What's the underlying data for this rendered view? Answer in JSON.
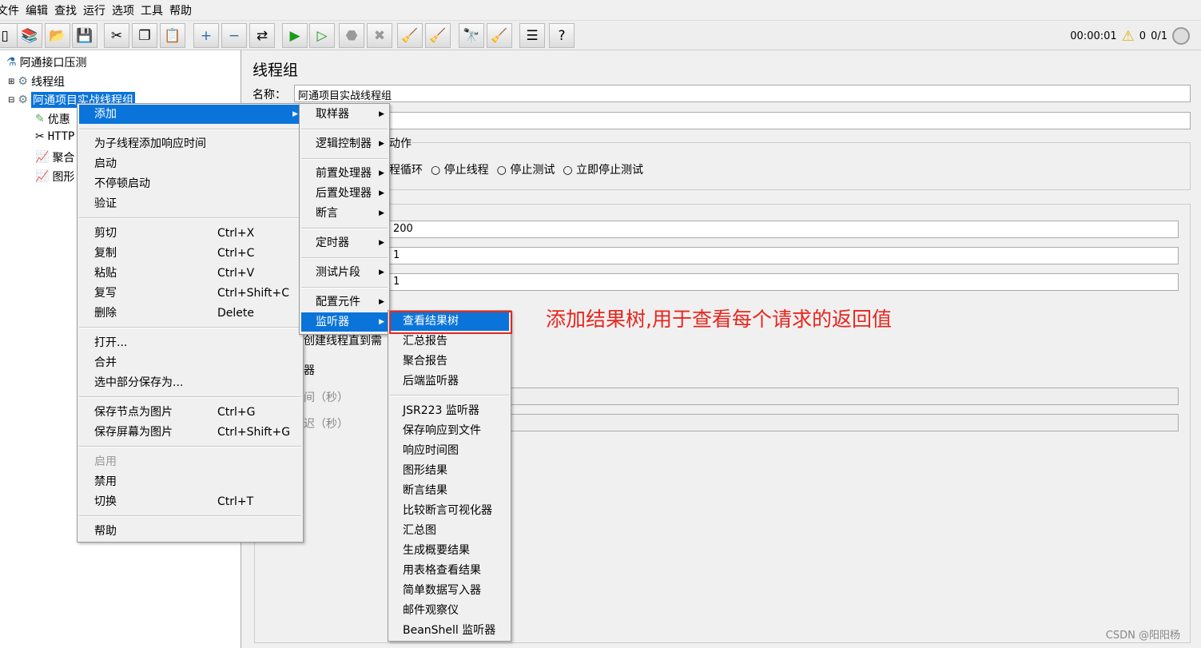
{
  "menubar": [
    "文件",
    "编辑",
    "查找",
    "运行",
    "选项",
    "工具",
    "帮助"
  ],
  "toolbar": {
    "icons": [
      "new-icon",
      "templates-icon",
      "open-icon",
      "save-icon",
      "cut-icon",
      "copy-icon",
      "paste-icon",
      "expand-icon",
      "collapse-icon",
      "toggle-icon",
      "start-icon",
      "start-no-pause-icon",
      "stop-icon",
      "shutdown-icon",
      "clear-icon",
      "clear-all-icon",
      "search-icon",
      "reset-search-icon",
      "function-helper-icon",
      "help-icon"
    ]
  },
  "status": {
    "timer": "00:00:01",
    "warnings": "0",
    "threads": "0/1"
  },
  "tree": {
    "root": "阿通接口压测",
    "items": [
      "线程组",
      "阿通项目实战线程组",
      "优惠",
      "HTTP",
      "聚合",
      "图形"
    ]
  },
  "panel": {
    "title": "线程组",
    "name_label": "名称：",
    "name_value": "阿通项目实战线程组",
    "action_group": "动作",
    "radios": [
      "程循环",
      "停止线程",
      "停止测试",
      "立即停止测试"
    ],
    "values": [
      "200",
      "1",
      "1"
    ],
    "create_text": "创建线程直到需",
    "label_qi": "器",
    "label_time": "间（秒）",
    "label_delay": "迟（秒）"
  },
  "context_menu": {
    "items": [
      {
        "label": "添加",
        "arrow": true
      },
      {
        "label": "为子线程添加响应时间"
      },
      {
        "label": "启动"
      },
      {
        "label": "不停顿启动"
      },
      {
        "label": "验证"
      },
      {
        "label": "剪切",
        "shortcut": "Ctrl+X"
      },
      {
        "label": "复制",
        "shortcut": "Ctrl+C"
      },
      {
        "label": "粘贴",
        "shortcut": "Ctrl+V"
      },
      {
        "label": "复写",
        "shortcut": "Ctrl+Shift+C"
      },
      {
        "label": "删除",
        "shortcut": "Delete"
      },
      {
        "label": "打开..."
      },
      {
        "label": "合并"
      },
      {
        "label": "选中部分保存为..."
      },
      {
        "label": "保存节点为图片",
        "shortcut": "Ctrl+G"
      },
      {
        "label": "保存屏幕为图片",
        "shortcut": "Ctrl+Shift+G"
      },
      {
        "label": "启用",
        "disabled": true
      },
      {
        "label": "禁用"
      },
      {
        "label": "切换",
        "shortcut": "Ctrl+T"
      },
      {
        "label": "帮助"
      }
    ]
  },
  "add_submenu": [
    "取样器",
    "逻辑控制器",
    "前置处理器",
    "后置处理器",
    "断言",
    "定时器",
    "测试片段",
    "配置元件",
    "监听器"
  ],
  "listener_submenu": [
    "查看结果树",
    "汇总报告",
    "聚合报告",
    "后端监听器",
    "JSR223 监听器",
    "保存响应到文件",
    "响应时间图",
    "图形结果",
    "断言结果",
    "比较断言可视化器",
    "汇总图",
    "生成概要结果",
    "用表格查看结果",
    "简单数据写入器",
    "邮件观察仪",
    "BeanShell 监听器"
  ],
  "annotation": "添加结果树,用于查看每个请求的返回值",
  "watermark": "CSDN @阳阳杨",
  "colors": {
    "highlight": "#0a74da",
    "annotation": "#e8261e"
  }
}
